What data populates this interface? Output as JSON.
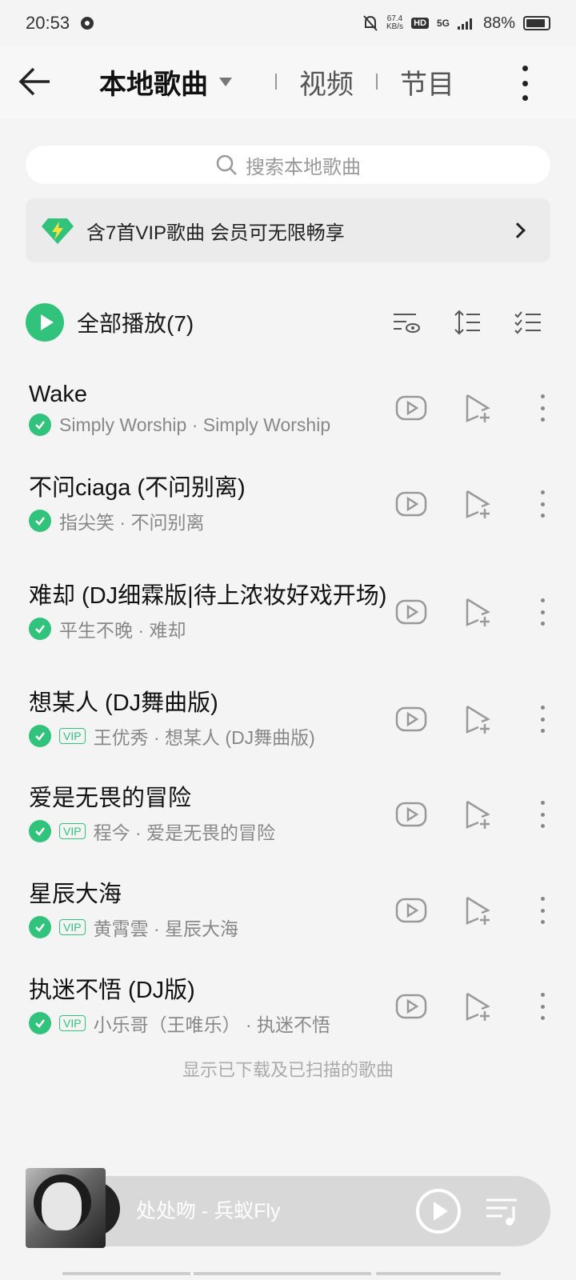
{
  "status": {
    "time": "20:53",
    "net_speed": "67.4",
    "net_unit": "KB/s",
    "hd": "HD",
    "network": "5G",
    "battery": "88%",
    "battery_level": 0.88
  },
  "header": {
    "tabs": [
      {
        "label": "本地歌曲",
        "active": true
      },
      {
        "label": "视频"
      },
      {
        "label": "节目"
      }
    ]
  },
  "search": {
    "placeholder": "搜索本地歌曲"
  },
  "vip_banner": {
    "text": "含7首VIP歌曲 会员可无限畅享"
  },
  "play_all": {
    "label": "全部播放(7)"
  },
  "songs": [
    {
      "title": "Wake",
      "subtitle": "Simply Worship · Simply Worship",
      "vip": false
    },
    {
      "title": "不问ciaga (不问别离)",
      "subtitle": "指尖笑 · 不问别离",
      "vip": false
    },
    {
      "title": "难却 (DJ细霖版|待上浓妆好戏开场)",
      "subtitle": "平生不晚 · 难却",
      "vip": false
    },
    {
      "title": "想某人 (DJ舞曲版)",
      "subtitle": "王优秀 · 想某人 (DJ舞曲版)",
      "vip": true
    },
    {
      "title": "爱是无畏的冒险",
      "subtitle": "程今 · 爱是无畏的冒险",
      "vip": true
    },
    {
      "title": "星辰大海",
      "subtitle": "黄霄雲 · 星辰大海",
      "vip": true
    },
    {
      "title": "执迷不悟 (DJ版)",
      "subtitle": "小乐哥（王唯乐） · 执迷不悟",
      "vip": true
    }
  ],
  "vip_label": "VIP",
  "footer_hint": "显示已下载及已扫描的歌曲",
  "player": {
    "now_playing": "处处吻 - 兵蚁Fly"
  },
  "colors": {
    "accent": "#31c27c",
    "banner_bg": "#ebebeb",
    "player_bg": "#d8d8d8"
  }
}
